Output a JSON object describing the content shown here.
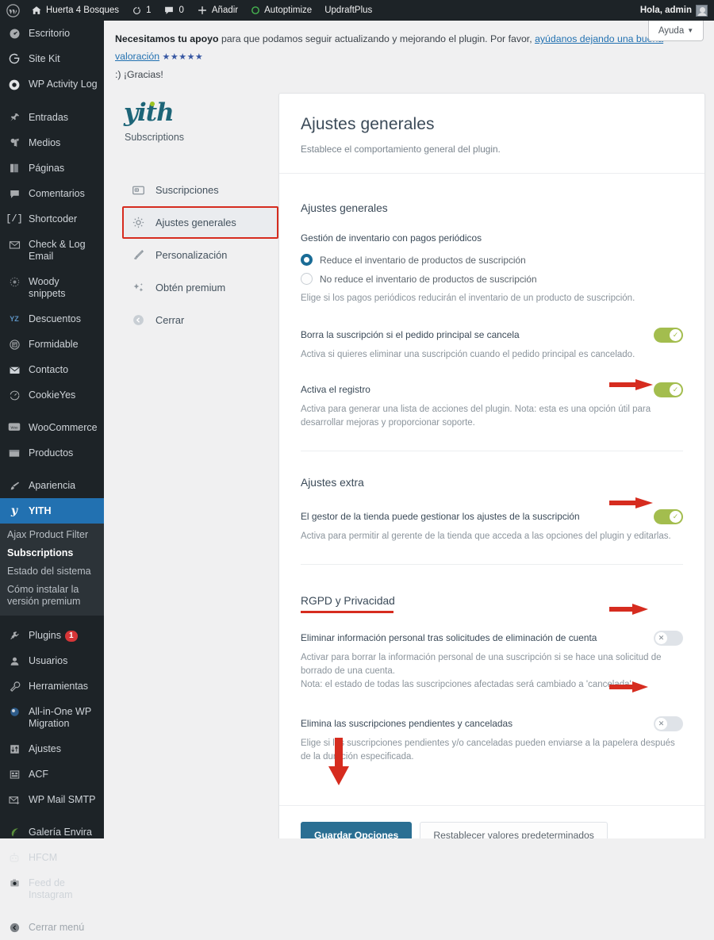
{
  "adminbar": {
    "site_name": "Huerta 4 Bosques",
    "updates_count": "1",
    "comments_count": "0",
    "add_label": "Añadir",
    "autoptimize_label": "Autoptimize",
    "updraft_label": "UpdraftPlus",
    "greeting": "Hola, admin"
  },
  "wpmenu": {
    "groups": [
      {
        "items": [
          {
            "label": "Escritorio",
            "icon": "dashboard-icon"
          },
          {
            "label": "Site Kit",
            "icon": "google-g-icon"
          },
          {
            "label": "WP Activity Log",
            "icon": "eye-icon"
          }
        ]
      },
      {
        "items": [
          {
            "label": "Entradas",
            "icon": "pin-icon"
          },
          {
            "label": "Medios",
            "icon": "media-icon"
          },
          {
            "label": "Páginas",
            "icon": "pages-icon"
          },
          {
            "label": "Comentarios",
            "icon": "comment-icon"
          },
          {
            "label": "Shortcoder",
            "icon": "brackets-slash-icon"
          },
          {
            "label": "Check & Log Email",
            "icon": "envelope-icon"
          },
          {
            "label": "Woody snippets",
            "icon": "woody-icon"
          },
          {
            "label": "Descuentos",
            "icon": "yz-icon"
          },
          {
            "label": "Formidable",
            "icon": "formidable-icon"
          },
          {
            "label": "Contacto",
            "icon": "mail-icon"
          },
          {
            "label": "CookieYes",
            "icon": "cookie-icon"
          }
        ]
      },
      {
        "items": [
          {
            "label": "WooCommerce",
            "icon": "woo-icon"
          },
          {
            "label": "Productos",
            "icon": "products-icon"
          }
        ]
      },
      {
        "items": [
          {
            "label": "Apariencia",
            "icon": "brush-icon"
          }
        ]
      }
    ],
    "yith": {
      "label": "YITH",
      "icon": "yith-y-icon",
      "submenu": [
        {
          "label": "Ajax Product Filter",
          "active": false
        },
        {
          "label": "Subscriptions",
          "active": true
        },
        {
          "label": "Estado del sistema",
          "active": false
        },
        {
          "label": "Cómo instalar la versión premium",
          "active": false
        }
      ]
    },
    "groups_after": [
      {
        "items": [
          {
            "label": "Plugins",
            "icon": "plug-icon",
            "badge": "1"
          },
          {
            "label": "Usuarios",
            "icon": "user-icon"
          },
          {
            "label": "Herramientas",
            "icon": "wrench-icon"
          },
          {
            "label": "All-in-One WP Migration",
            "icon": "migration-icon"
          },
          {
            "label": "Ajustes",
            "icon": "settings-sliders-icon"
          },
          {
            "label": "ACF",
            "icon": "acf-grid-icon"
          },
          {
            "label": "WP Mail SMTP",
            "icon": "mail-send-icon"
          }
        ]
      },
      {
        "items": [
          {
            "label": "Galería Envira",
            "icon": "leaf-icon"
          },
          {
            "label": "HFCM",
            "icon": "robot-icon"
          },
          {
            "label": "Feed de Instagram",
            "icon": "camera-icon"
          }
        ]
      }
    ],
    "collapse_label": "Cerrar menú",
    "collapse_icon": "collapse-arrow-icon"
  },
  "help_tab": {
    "label": "Ayuda",
    "caret_icon": "chevron-down-icon"
  },
  "notice": {
    "bold_lead": "Necesitamos tu apoyo",
    "text_before_link": " para que podamos seguir actualizando y mejorando el plugin. Por favor, ",
    "link_text": "ayúdanos dejando una buena valoración",
    "stars": "★★★★★",
    "thanks": ":) ¡Gracias!"
  },
  "plugin_nav": {
    "logo_text": "yith",
    "logo_subtitle": "Subscriptions",
    "items": [
      {
        "label": "Suscripciones",
        "icon": "subscriptions-card-icon",
        "selected": false
      },
      {
        "label": "Ajustes generales",
        "icon": "gear-icon",
        "selected": true
      },
      {
        "label": "Personalización",
        "icon": "paintbrush-icon",
        "selected": false
      },
      {
        "label": "Obtén premium",
        "icon": "sparkles-icon",
        "selected": false
      },
      {
        "label": "Cerrar",
        "icon": "back-arrow-icon",
        "selected": false
      }
    ]
  },
  "panel": {
    "title": "Ajustes generales",
    "description": "Establece el comportamiento general del plugin.",
    "sections": [
      {
        "id": "general",
        "title": "Ajustes generales",
        "underlined": false,
        "fields": [
          {
            "type": "radio",
            "label": "Gestión de inventario con pagos periódicos",
            "options": [
              {
                "label": "Reduce el inventario de productos de suscripción",
                "selected": true
              },
              {
                "label": "No reduce el inventario de productos de suscripción",
                "selected": false
              }
            ],
            "help": "Elige si los pagos periódicos reducirán el inventario de un producto de suscripción."
          },
          {
            "type": "toggle",
            "label": "Borra la suscripción si el pedido principal se cancela",
            "value": "on",
            "help": "Activa si quieres eliminar una suscripción cuando el pedido principal es cancelado."
          },
          {
            "type": "toggle",
            "label": "Activa el registro",
            "value": "on",
            "help": "Activa para generar una lista de acciones del plugin. Nota: esta es una opción útil para desarrollar mejoras y proporcionar soporte."
          }
        ]
      },
      {
        "id": "extra",
        "title": "Ajustes extra",
        "underlined": false,
        "fields": [
          {
            "type": "toggle",
            "label": "El gestor de la tienda puede gestionar los ajustes de la suscripción",
            "value": "on",
            "help": "Activa para permitir al gerente de la tienda que acceda a las opciones del plugin y editarlas."
          }
        ]
      },
      {
        "id": "rgpd",
        "title": "RGPD y Privacidad",
        "underlined": true,
        "fields": [
          {
            "type": "toggle",
            "label": "Eliminar información personal tras solicitudes de eliminación de cuenta",
            "value": "off",
            "help": "Activar para borrar la información personal de una suscripción si se hace una solicitud de borrado de una cuenta.\nNota: el estado de todas las suscripciones afectadas será cambiado a 'cancelada'"
          },
          {
            "type": "toggle",
            "label": "Elimina las suscripciones pendientes y canceladas",
            "value": "off",
            "help": "Elige si las suscripciones pendientes y/o canceladas pueden enviarse a la papelera después de la duración especificada."
          }
        ]
      }
    ],
    "save_label": "Guardar Opciones",
    "reset_label": "Restablecer valores predeterminados"
  },
  "toggle_glyphs": {
    "on": "✓",
    "off": "✕"
  },
  "colors": {
    "wp_menu_bg": "#1d2327",
    "wp_menu_current": "#2271b1",
    "toggle_on": "#a3bd4e",
    "toggle_off": "#dfe3e8",
    "radio_on": "#1a6c96",
    "annotation_red": "#d62c1f",
    "primary_button": "#2b6f93",
    "logo_teal": "#1d6578",
    "logo_dot_green": "#9cc321",
    "link_blue": "#2271b1"
  },
  "annotations": {
    "arrow_count": 5,
    "color": "#d62c1f"
  }
}
